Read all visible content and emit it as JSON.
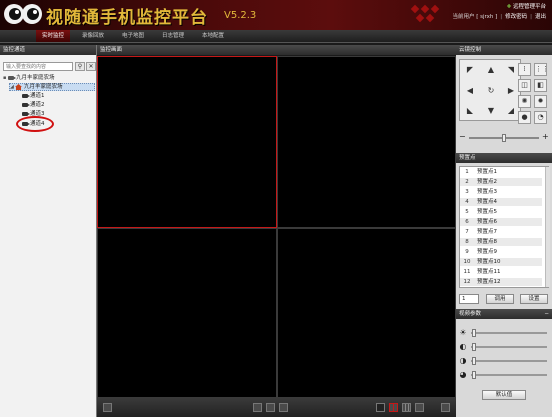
{
  "app": {
    "title": "视随通手机监控平台",
    "version": "V5.2.3",
    "remote_label": "远程管理平台",
    "user_label": "当前用户 [ sjrxh ]",
    "change_password": "修改密码",
    "logout": "退出"
  },
  "menu": {
    "items": [
      {
        "label": "实时监控",
        "active": true
      },
      {
        "label": "录像回放",
        "active": false
      },
      {
        "label": "电子地图",
        "active": false
      },
      {
        "label": "日志管理",
        "active": false
      },
      {
        "label": "本地配置",
        "active": false
      }
    ]
  },
  "left": {
    "header": "监控通道",
    "search_placeholder": "输入要查找的内容",
    "search_icon": "search-icon",
    "clear_icon": "close-icon",
    "tree": {
      "root": "九月丰家庭农场",
      "group": "九月丰家庭农场",
      "channels": [
        "通道1",
        "通道2",
        "通道3",
        "通道4"
      ],
      "selected_channel": "通道4"
    }
  },
  "video": {
    "header": "监控画面",
    "layout": "2x2",
    "active_cell": 0,
    "colors": {
      "active_border": "#c41818"
    }
  },
  "ptz": {
    "header": "云镜控制",
    "icons": [
      "arrow-up-left-icon",
      "arrow-up-icon",
      "arrow-up-right-icon",
      "arrow-left-icon",
      "auto-rotate-icon",
      "arrow-right-icon",
      "arrow-down-left-icon",
      "arrow-down-icon",
      "arrow-down-right-icon"
    ],
    "side_icons": [
      "zoom-in-icon",
      "zoom-out-icon",
      "focus-near-icon",
      "focus-far-icon",
      "iris-open-icon",
      "iris-close-icon",
      "light-icon",
      "wiper-icon"
    ],
    "speed_minus": "−",
    "speed_plus": "+",
    "speed": 0.5
  },
  "presets": {
    "header": "预置点",
    "items": [
      {
        "num": "1",
        "name": "预置点1"
      },
      {
        "num": "2",
        "name": "预置点2"
      },
      {
        "num": "3",
        "name": "预置点3"
      },
      {
        "num": "4",
        "name": "预置点4"
      },
      {
        "num": "5",
        "name": "预置点5"
      },
      {
        "num": "6",
        "name": "预置点6"
      },
      {
        "num": "7",
        "name": "预置点7"
      },
      {
        "num": "8",
        "name": "预置点8"
      },
      {
        "num": "9",
        "name": "预置点9"
      },
      {
        "num": "10",
        "name": "预置点10"
      },
      {
        "num": "11",
        "name": "预置点11"
      },
      {
        "num": "12",
        "name": "预置点12"
      }
    ],
    "stepper_value": "1",
    "call_label": "调用",
    "set_label": "设置"
  },
  "video_params": {
    "header": "视频参数",
    "collapse": "−",
    "params": [
      {
        "icon": "brightness-icon",
        "level": 0.02
      },
      {
        "icon": "contrast-icon",
        "level": 0.02
      },
      {
        "icon": "saturation-icon",
        "level": 0.02
      },
      {
        "icon": "hue-icon",
        "level": 0.02
      }
    ],
    "default_label": "默认值"
  }
}
